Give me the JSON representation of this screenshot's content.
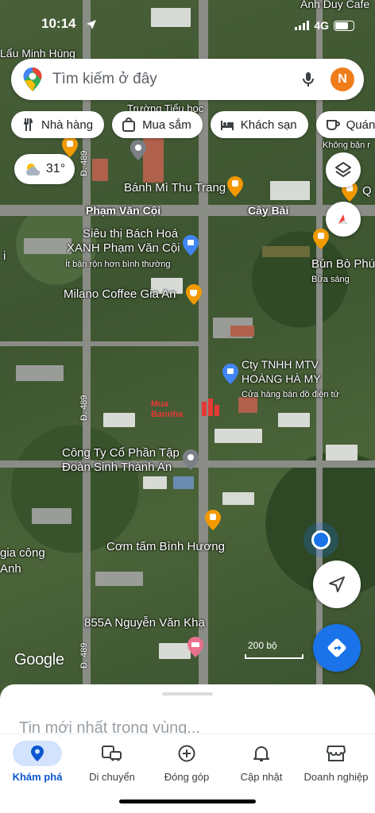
{
  "status_bar": {
    "time": "10:14",
    "network": "4G"
  },
  "search": {
    "placeholder": "Tìm kiếm ở đây",
    "avatar_initial": "N"
  },
  "chips": [
    {
      "label": "Nhà hàng",
      "icon": "fork-knife-icon"
    },
    {
      "label": "Mua sắm",
      "icon": "shopping-bag-icon"
    },
    {
      "label": "Khách sạn",
      "icon": "bed-icon"
    },
    {
      "label": "Quán",
      "icon": "coffee-cup-icon"
    }
  ],
  "weather": {
    "temp": "31°",
    "icon": "partly-cloudy-icon"
  },
  "map": {
    "places": {
      "lau": "Lẩu Minh Hùng",
      "anh_duy": "Anh Duy Cafe",
      "truong": "Trường Tiểu học",
      "khong_ban": "Không bận r",
      "banh_mi": "Bánh Mì Thu Trang",
      "q": "Q",
      "pham_van_coi": "Phạm Văn Cội",
      "cay_bai": "Cây Bài",
      "sieu_thi_1": "Siêu thị Bách Hoá",
      "sieu_thi_2": "XANH Phạm Văn Cội",
      "sieu_thi_sub": "Ít bận rộn hơn bình thường",
      "bun_bo": "Bún Bò Phú",
      "bun_bo_sub": "Bữa sáng",
      "milano": "Milano Coffee Gia An",
      "cty_1": "Cty TNHH MTV",
      "cty_2": "HOÀNG HÀ MY",
      "cty_sub": "Cửa hàng bán đồ điện tử",
      "cong_ty_1": "Công Ty Cổ Phần Tập",
      "cong_ty_2": "Đoàn Sinh Thành An",
      "com_tam": "Cơm tấm Bình Hương",
      "gia_cong_1": "gia công",
      "gia_cong_2": "Anh",
      "nguyen_van_kha": "855A Nguyễn Văn Khạ",
      "left_i": "i"
    },
    "road_489": "Đ. 489",
    "google": "Google",
    "scale": "200 bộ",
    "watermark": "Mua Bannha"
  },
  "sheet": {
    "title": "Tin mới nhất trong vùng..."
  },
  "nav": [
    {
      "label": "Khám phá",
      "icon": "explore-pin-icon",
      "active": true
    },
    {
      "label": "Di chuyển",
      "icon": "commute-icon",
      "active": false
    },
    {
      "label": "Đóng góp",
      "icon": "add-circle-icon",
      "active": false
    },
    {
      "label": "Cập nhật",
      "icon": "bell-icon",
      "active": false
    },
    {
      "label": "Doanh nghiệp",
      "icon": "storefront-icon",
      "active": false
    }
  ],
  "colors": {
    "accent": "#1a73e8",
    "active_nav_bg": "#d3e3fd",
    "avatar": "#f07d1b",
    "pin_orange": "#f29900",
    "pin_blue": "#4285f4"
  }
}
